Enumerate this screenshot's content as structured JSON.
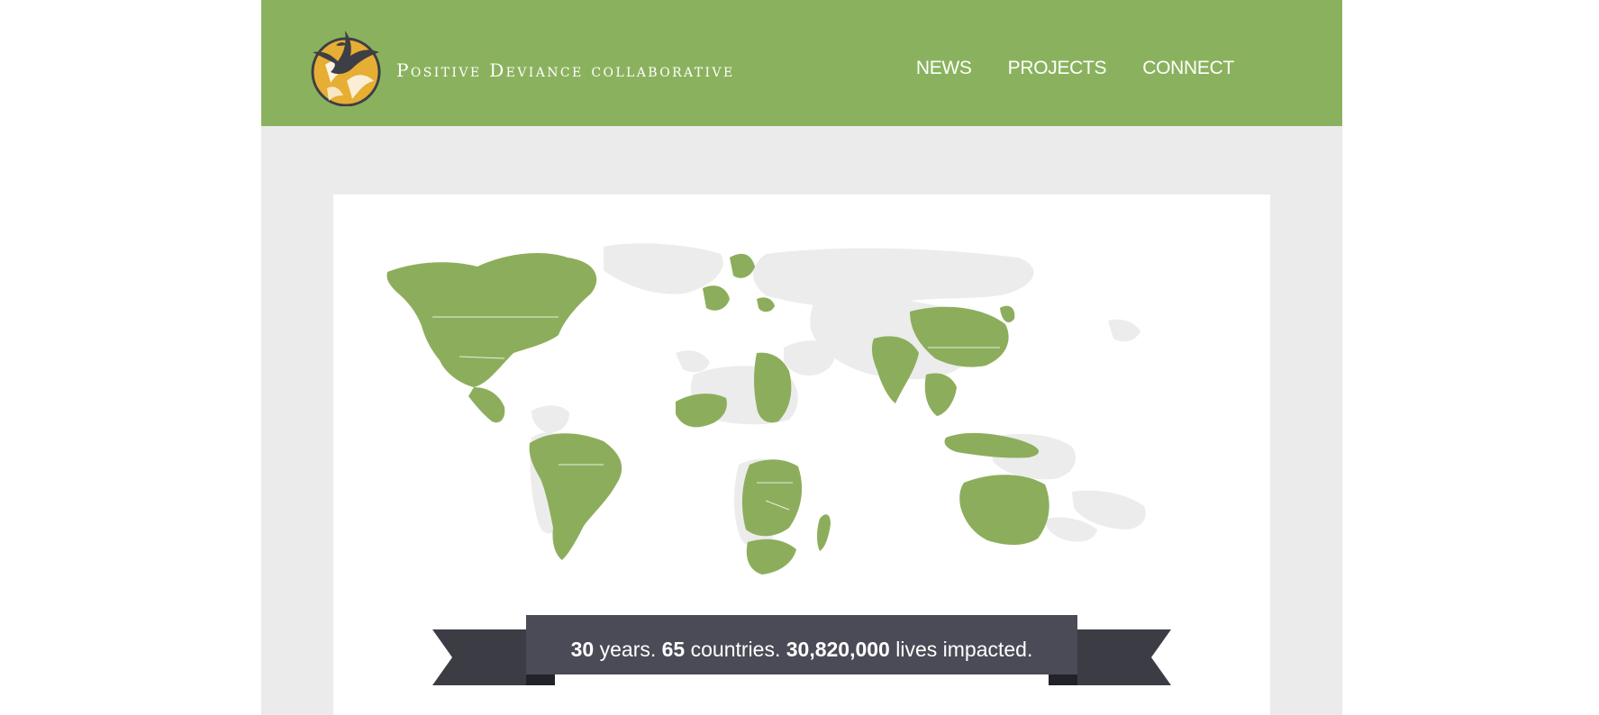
{
  "header": {
    "brand": "Positive Deviance collaborative",
    "nav": [
      "NEWS",
      "PROJECTS",
      "CONNECT"
    ]
  },
  "banner": {
    "years": "30",
    "years_label": " years. ",
    "countries": "65",
    "countries_label": " countries. ",
    "lives": "30,820,000",
    "lives_label": " lives impacted."
  },
  "colors": {
    "header": "#8ab25e",
    "highlight_country": "#8cae5c",
    "other_country": "#ececec",
    "ribbon": "#3c3c45",
    "ribbon_center": "#4b4b57"
  },
  "icons": {
    "logo": "bird-circle-logo",
    "map": "world-map"
  }
}
